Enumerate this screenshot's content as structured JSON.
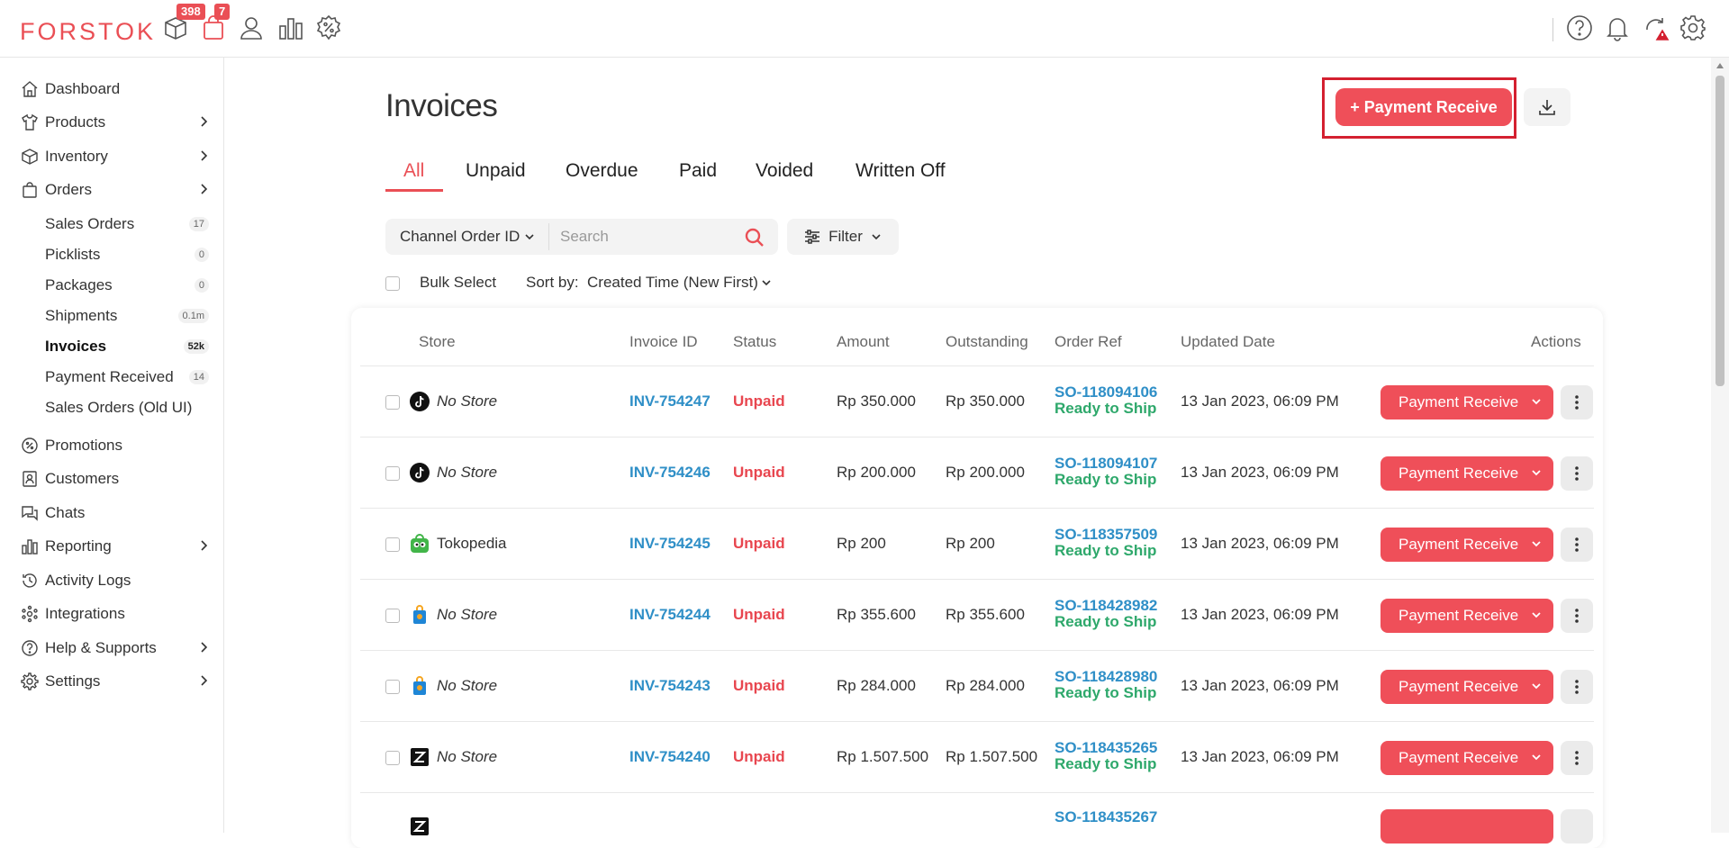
{
  "app": {
    "logo": "FORSTOK",
    "badges": {
      "inventory": "398",
      "orders": "7"
    }
  },
  "sidebar": {
    "items": [
      {
        "label": "Dashboard",
        "icon": "home-icon"
      },
      {
        "label": "Products",
        "icon": "shirt-icon"
      },
      {
        "label": "Inventory",
        "icon": "box-icon"
      },
      {
        "label": "Orders",
        "icon": "bag-icon"
      },
      {
        "label": "Promotions",
        "icon": "discount-icon"
      },
      {
        "label": "Customers",
        "icon": "contact-icon"
      },
      {
        "label": "Chats",
        "icon": "chat-icon"
      },
      {
        "label": "Reporting",
        "icon": "bar-chart-icon"
      },
      {
        "label": "Activity Logs",
        "icon": "history-icon"
      },
      {
        "label": "Integrations",
        "icon": "integration-icon"
      },
      {
        "label": "Help & Supports",
        "icon": "help-icon"
      },
      {
        "label": "Settings",
        "icon": "gear-icon"
      }
    ],
    "sub_items": [
      {
        "label": "Sales Orders",
        "count": "17"
      },
      {
        "label": "Picklists",
        "count": "0"
      },
      {
        "label": "Packages",
        "count": "0"
      },
      {
        "label": "Shipments",
        "count": "0.1m"
      },
      {
        "label": "Invoices",
        "count": "52k"
      },
      {
        "label": "Payment Received",
        "count": "14"
      },
      {
        "label": "Sales Orders (Old UI)",
        "count": ""
      }
    ]
  },
  "page": {
    "title": "Invoices",
    "primary_button": "+ Payment Receive",
    "tabs": [
      "All",
      "Unpaid",
      "Overdue",
      "Paid",
      "Voided",
      "Written Off"
    ],
    "search_select": "Channel Order ID",
    "search_placeholder": "Search",
    "filter_label": "Filter",
    "bulk_select_label": "Bulk Select",
    "sort_label": "Sort by:",
    "sort_value": "Created Time (New First)"
  },
  "table": {
    "headers": [
      "Store",
      "Invoice ID",
      "Status",
      "Amount",
      "Outstanding",
      "Order Ref",
      "Updated Date",
      "Actions"
    ],
    "action_label": "Payment Receive",
    "rows": [
      {
        "store": "No Store",
        "store_icon": "tiktok-icon",
        "invoice": "INV-754247",
        "status": "Unpaid",
        "amount": "Rp 350.000",
        "outstanding": "Rp 350.000",
        "order_ref": "SO-118094106",
        "ref_status": "Ready to Ship",
        "updated": "13 Jan 2023, 06:09 PM"
      },
      {
        "store": "No Store",
        "store_icon": "tiktok-icon",
        "invoice": "INV-754246",
        "status": "Unpaid",
        "amount": "Rp 200.000",
        "outstanding": "Rp 200.000",
        "order_ref": "SO-118094107",
        "ref_status": "Ready to Ship",
        "updated": "13 Jan 2023, 06:09 PM"
      },
      {
        "store": "Tokopedia",
        "store_icon": "tokopedia-icon",
        "invoice": "INV-754245",
        "status": "Unpaid",
        "amount": "Rp 200",
        "outstanding": "Rp 200",
        "order_ref": "SO-118357509",
        "ref_status": "Ready to Ship",
        "updated": "13 Jan 2023, 06:09 PM"
      },
      {
        "store": "No Store",
        "store_icon": "shopping-bag-icon",
        "invoice": "INV-754244",
        "status": "Unpaid",
        "amount": "Rp 355.600",
        "outstanding": "Rp 355.600",
        "order_ref": "SO-118428982",
        "ref_status": "Ready to Ship",
        "updated": "13 Jan 2023, 06:09 PM"
      },
      {
        "store": "No Store",
        "store_icon": "shopping-bag-icon",
        "invoice": "INV-754243",
        "status": "Unpaid",
        "amount": "Rp 284.000",
        "outstanding": "Rp 284.000",
        "order_ref": "SO-118428980",
        "ref_status": "Ready to Ship",
        "updated": "13 Jan 2023, 06:09 PM"
      },
      {
        "store": "No Store",
        "store_icon": "zalora-icon",
        "invoice": "INV-754240",
        "status": "Unpaid",
        "amount": "Rp 1.507.500",
        "outstanding": "Rp 1.507.500",
        "order_ref": "SO-118435265",
        "ref_status": "Ready to Ship",
        "updated": "13 Jan 2023, 06:09 PM"
      },
      {
        "store": "",
        "store_icon": "zalora-icon",
        "invoice": "",
        "status": "",
        "amount": "",
        "outstanding": "",
        "order_ref": "SO-118435267",
        "ref_status": "",
        "updated": ""
      }
    ]
  },
  "colors": {
    "brand": "#ea4f55",
    "link": "#2f8fc7",
    "unpaid": "#e8464f",
    "ready": "#2ea86b"
  }
}
